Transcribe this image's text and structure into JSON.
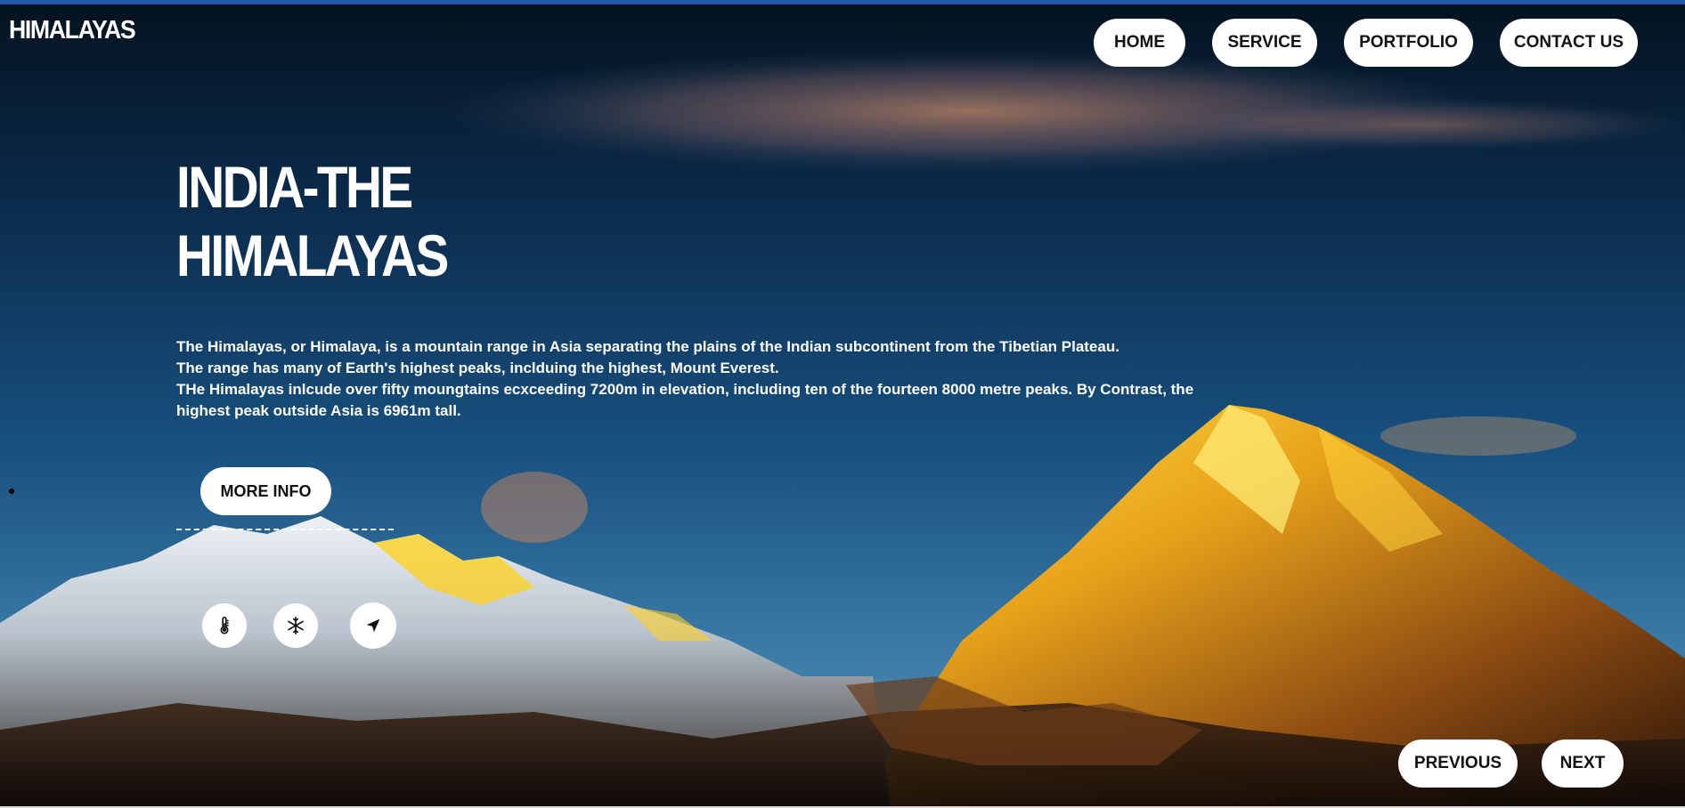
{
  "brand": {
    "logo_text": "HIMALAYAS"
  },
  "nav": {
    "items": [
      {
        "label": "HOME"
      },
      {
        "label": "SERVICE"
      },
      {
        "label": "PORTFOLIO"
      },
      {
        "label": "CONTACT US"
      }
    ]
  },
  "hero": {
    "title_line1": "INDIA-THE",
    "title_line2": "HIMALAYAS",
    "paragraphs": [
      "The Himalayas, or Himalaya, is a mountain range in Asia separating the plains of the Indian subcontinent from the Tibetian Plateau.",
      "The range has many of Earth's highest peaks, inclduing the highest, Mount Everest.",
      "THe Himalayas inlcude over fifty moungtains ecxceeding 7200m in elevation, including ten of the fourteen 8000 metre peaks. By Contrast, the highest peak outside Asia is 6961m tall."
    ],
    "more_info_label": "MORE INFO"
  },
  "icons": [
    "thermometer-icon",
    "snowflake-icon",
    "navigation-arrow-icon"
  ],
  "pager": {
    "previous_label": "PREVIOUS",
    "next_label": "NEXT"
  },
  "colors": {
    "top_bar": "#1f5aa8",
    "sky_top": "#041526",
    "sky_mid": "#164a78",
    "sky_low": "#3a79a8",
    "peak_glow": "#f2c21a"
  }
}
